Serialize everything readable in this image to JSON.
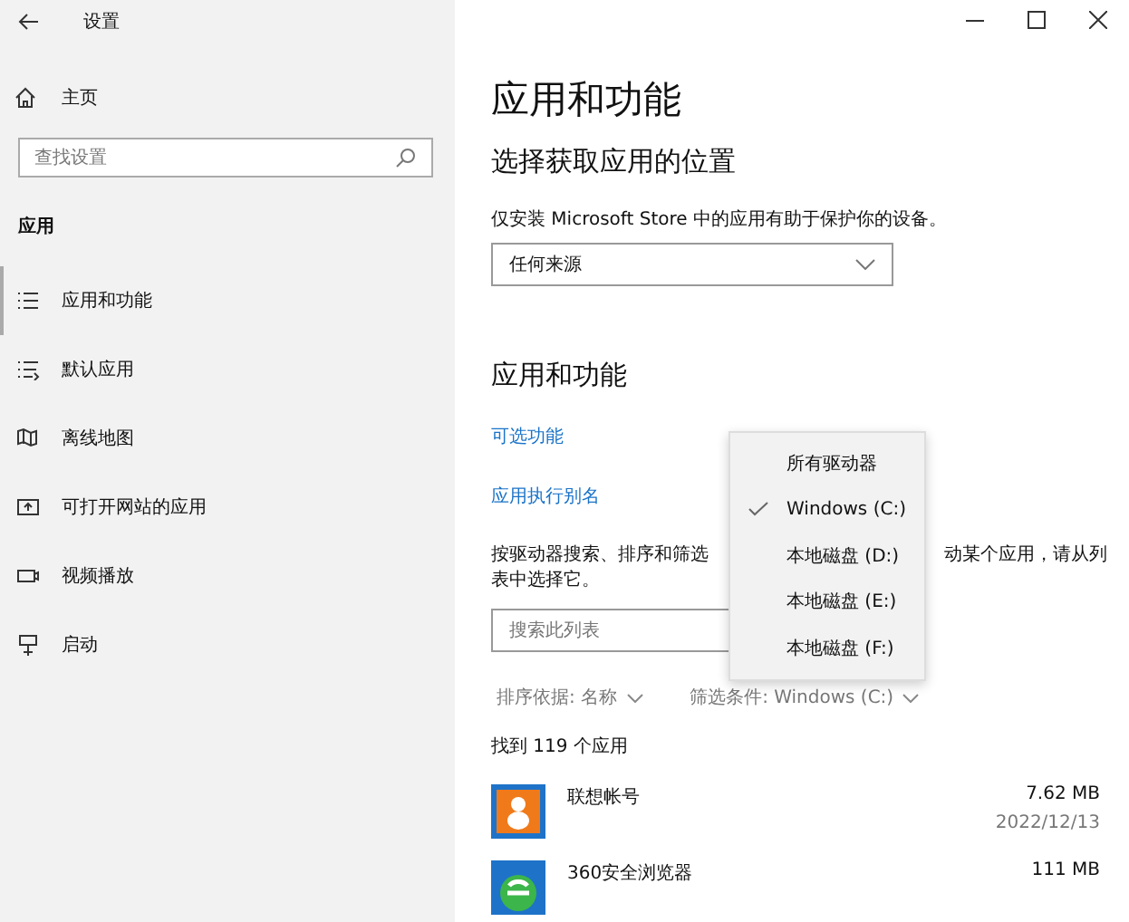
{
  "window": {
    "title": "设置"
  },
  "sidebar": {
    "home": "主页",
    "search": {
      "placeholder": "查找设置"
    },
    "section": "应用",
    "items": [
      {
        "label": "应用和功能",
        "selected": true
      },
      {
        "label": "默认应用",
        "selected": false
      },
      {
        "label": "离线地图",
        "selected": false
      },
      {
        "label": "可打开网站的应用",
        "selected": false
      },
      {
        "label": "视频播放",
        "selected": false
      },
      {
        "label": "启动",
        "selected": false
      }
    ]
  },
  "main": {
    "title": "应用和功能",
    "location_heading": "选择获取应用的位置",
    "location_note": "仅安装 Microsoft Store 中的应用有助于保护你的设备。",
    "source_dropdown": "任何来源",
    "apps_heading": "应用和功能",
    "links": [
      "可选功能",
      "应用执行别名"
    ],
    "filter_note": {
      "left": "按驱动器搜索、排序和筛选",
      "right": "动某个应用，请从列",
      "line2": "表中选择它。"
    },
    "list_search": {
      "placeholder": "搜索此列表"
    },
    "sort": "排序依据: 名称",
    "filter": "筛选条件: Windows (C:)",
    "count": "找到 119 个应用",
    "apps": [
      {
        "name": "联想帐号",
        "size": "7.62 MB",
        "date": "2022/12/13"
      },
      {
        "name": "360安全浏览器",
        "size": "111 MB"
      }
    ]
  },
  "drive_menu": {
    "items": [
      {
        "label": "所有驱动器",
        "selected": false
      },
      {
        "label": "Windows (C:)",
        "selected": true
      },
      {
        "label": "本地磁盘 (D:)",
        "selected": false
      },
      {
        "label": "本地磁盘 (E:)",
        "selected": false
      },
      {
        "label": "本地磁盘 (F:)",
        "selected": false
      }
    ]
  }
}
